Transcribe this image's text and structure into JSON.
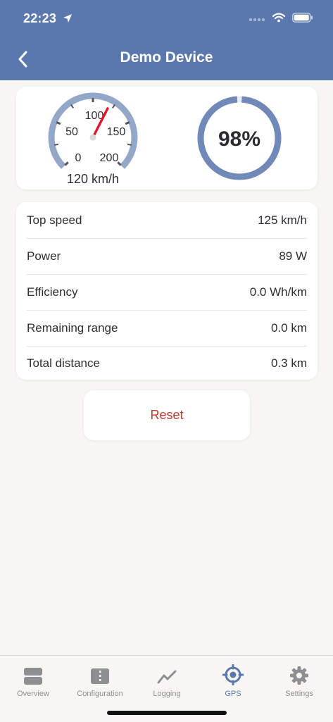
{
  "status_bar": {
    "time": "22:23"
  },
  "header": {
    "title": "Demo Device"
  },
  "speedometer": {
    "ticks": [
      "0",
      "50",
      "100",
      "150",
      "200"
    ],
    "readout": "120 km/h",
    "needle_value": 120,
    "max": 200
  },
  "battery": {
    "percent_label": "98%",
    "level": 0.98
  },
  "stats": [
    {
      "label": "Top speed",
      "value": "125 km/h"
    },
    {
      "label": "Power",
      "value": "89 W"
    },
    {
      "label": "Efficiency",
      "value": "0.0 Wh/km"
    },
    {
      "label": "Remaining range",
      "value": "0.0 km"
    },
    {
      "label": "Total distance",
      "value": "0.3 km"
    }
  ],
  "reset_label": "Reset",
  "tabs": [
    {
      "label": "Overview",
      "icon": "overview-icon"
    },
    {
      "label": "Configuration",
      "icon": "configuration-icon"
    },
    {
      "label": "Logging",
      "icon": "logging-icon"
    },
    {
      "label": "GPS",
      "icon": "gps-icon",
      "active": true
    },
    {
      "label": "Settings",
      "icon": "settings-icon"
    }
  ],
  "colors": {
    "accent": "#5a78ad",
    "danger": "#c0392b",
    "needle": "#e0182d"
  }
}
